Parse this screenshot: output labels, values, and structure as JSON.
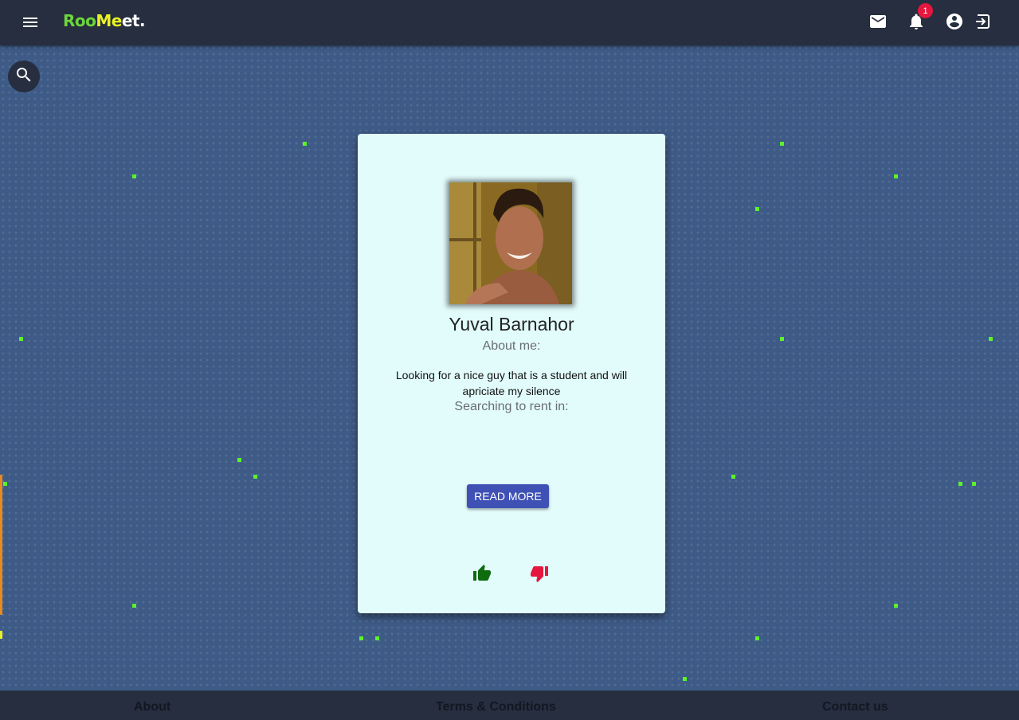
{
  "app": {
    "logo_part1": "Roo",
    "logo_part2": "Me",
    "logo_part3": "et."
  },
  "topbar": {
    "notification_count": "1",
    "icons": [
      "menu-icon",
      "mail-icon",
      "bell-icon",
      "account-circle-icon",
      "logout-icon"
    ]
  },
  "search": {
    "icon": "search-icon"
  },
  "profile": {
    "name": "Yuval Barnahor",
    "about_label": "About me:",
    "about_text": "Looking for a nice guy that is a student and will apriciate my silence",
    "rent_label": "Searching to rent in:",
    "read_more_label": "READ MORE",
    "like_icon": "thumb-up-icon",
    "dislike_icon": "thumb-down-icon"
  },
  "footer": {
    "about": "About",
    "terms": "Terms & Conditions",
    "contact": "Contact us"
  },
  "colors": {
    "topbar": "#262e3f",
    "background": "#3e5b87",
    "card": "#e2fbfb",
    "accent_button": "#3f51b5",
    "like": "#0e6b0e",
    "dislike": "#e5173f",
    "badge": "#e5173f",
    "logo_green": "#6bd639",
    "logo_yellow": "#e9f224",
    "particles": "#5cf22c"
  }
}
